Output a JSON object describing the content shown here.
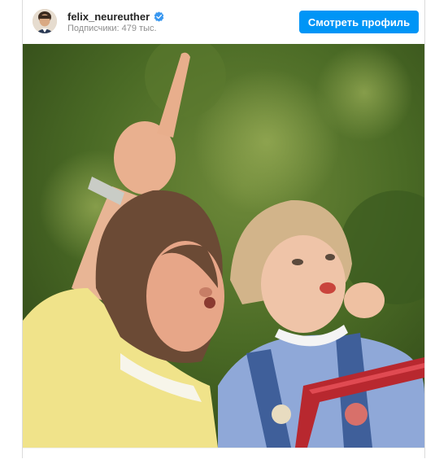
{
  "profile": {
    "username": "felix_neureuther",
    "verified": true,
    "followers_text": "Подписчики: 479 тыс.",
    "view_profile_label": "Смотреть профиль"
  },
  "colors": {
    "accent": "#0095f6",
    "verified_badge": "#3897f0"
  },
  "post": {
    "image_description_icon": "photo-content"
  }
}
